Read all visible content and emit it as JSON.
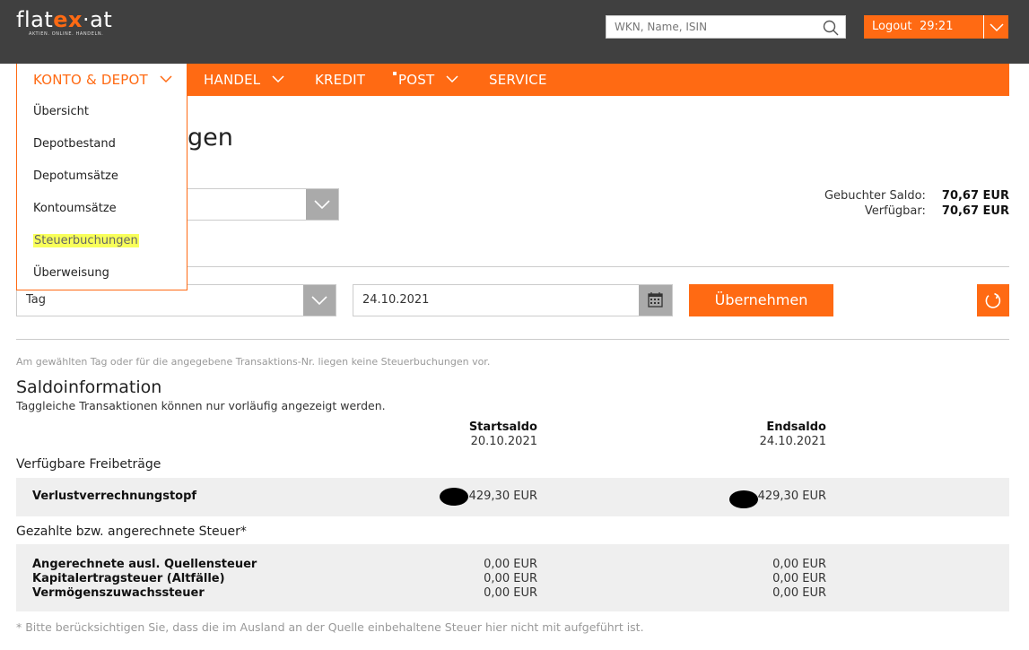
{
  "header": {
    "logo_text_a": "flat",
    "logo_text_b": "ex",
    "logo_text_c": "·at",
    "logo_tagline": "AKTIEN. ONLINE. HANDELN.",
    "search_placeholder": "WKN, Name, ISIN",
    "logout_label": "Logout",
    "logout_timer": "29:21"
  },
  "nav": {
    "items": [
      {
        "label": "KONTO & DEPOT"
      },
      {
        "label": "HANDEL"
      },
      {
        "label": "KREDIT"
      },
      {
        "label": "POST"
      },
      {
        "label": "SERVICE"
      }
    ]
  },
  "dropdown": {
    "items": [
      {
        "label": "Übersicht"
      },
      {
        "label": "Depotbestand"
      },
      {
        "label": "Depotumsätze"
      },
      {
        "label": "Kontoumsätze"
      },
      {
        "label": "Steuerbuchungen"
      },
      {
        "label": "Überweisung"
      }
    ]
  },
  "page": {
    "title_partial": "gen"
  },
  "balance": {
    "booked_label": "Gebuchter Saldo:",
    "booked_value": "70,67 EUR",
    "available_label": "Verfügbar:",
    "available_value": "70,67 EUR"
  },
  "filter": {
    "period_value": "Tag",
    "date_value": "24.10.2021",
    "apply_label": "Übernehmen"
  },
  "notice": "Am gewählten Tag oder für die angegebene Transaktions-Nr. liegen keine Steuerbuchungen vor.",
  "saldo": {
    "title": "Saldoinformation",
    "subtitle": "Taggleiche Transaktionen können nur vorläufig angezeigt werden.",
    "start_header": "Startsaldo",
    "start_date": "20.10.2021",
    "end_header": "Endsaldo",
    "end_date": "24.10.2021",
    "group1_title": "Verfügbare Freibeträge",
    "group1_rows": [
      {
        "label": "Verlustverrechnungstopf",
        "start": "429,30 EUR",
        "end": "429,30 EUR"
      }
    ],
    "group2_title": "Gezahlte bzw. angerechnete Steuer*",
    "group2_rows": [
      {
        "label": "Angerechnete ausl. Quellensteuer",
        "start": "0,00 EUR",
        "end": "0,00 EUR"
      },
      {
        "label": "Kapitalertragsteuer (Altfälle)",
        "start": "0,00 EUR",
        "end": "0,00 EUR"
      },
      {
        "label": "Vermögenszuwachssteuer",
        "start": "0,00 EUR",
        "end": "0,00 EUR"
      }
    ]
  },
  "footnote": "* Bitte berücksichtigen Sie, dass die im Ausland an der Quelle einbehaltene Steuer hier nicht mit aufgeführt ist.",
  "colors": {
    "brand_orange": "#ff6a13",
    "header_dark": "#404040",
    "highlight_yellow": "#f8ff5a"
  }
}
